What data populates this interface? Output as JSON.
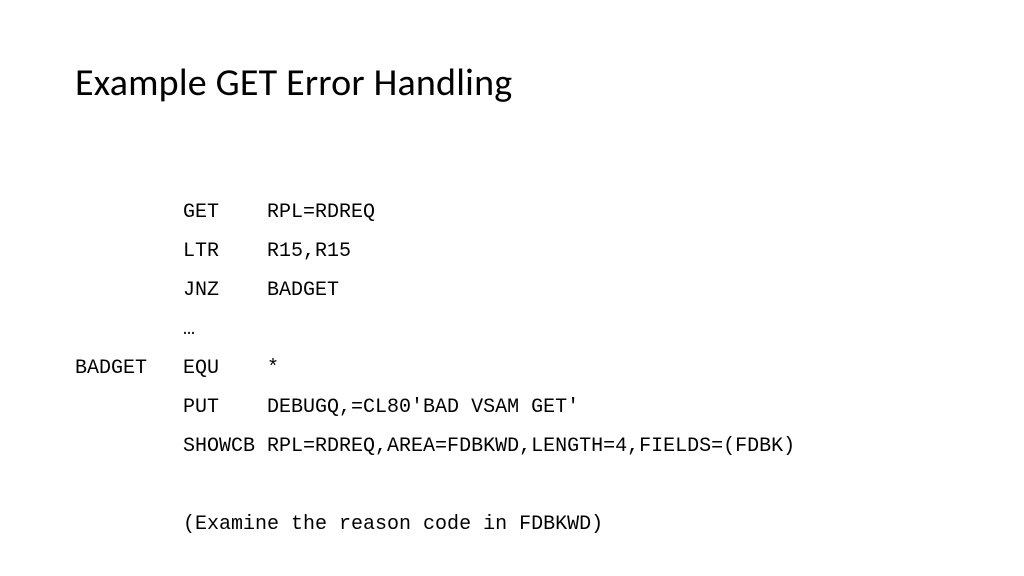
{
  "title": "Example GET Error Handling",
  "code": {
    "l1": "         GET    RPL=RDREQ",
    "l2": "         LTR    R15,R15",
    "l3": "         JNZ    BADGET",
    "l4": "         …",
    "l5": "BADGET   EQU    *",
    "l6": "         PUT    DEBUGQ,=CL80'BAD VSAM GET'",
    "l7": "         SHOWCB RPL=RDREQ,AREA=FDBKWD,LENGTH=4,FIELDS=(FDBK)",
    "l8": "",
    "l9": "         (Examine the reason code in FDBKWD)"
  }
}
